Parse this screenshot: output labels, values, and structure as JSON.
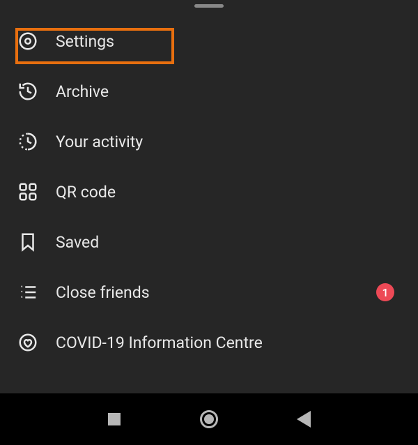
{
  "menu": {
    "items": [
      {
        "label": "Settings",
        "icon": "settings-icon",
        "badge": null,
        "highlighted": true
      },
      {
        "label": "Archive",
        "icon": "archive-icon",
        "badge": null,
        "highlighted": false
      },
      {
        "label": "Your activity",
        "icon": "activity-icon",
        "badge": null,
        "highlighted": false
      },
      {
        "label": "QR code",
        "icon": "qr-icon",
        "badge": null,
        "highlighted": false
      },
      {
        "label": "Saved",
        "icon": "bookmark-icon",
        "badge": null,
        "highlighted": false
      },
      {
        "label": "Close friends",
        "icon": "close-friends-icon",
        "badge": "1",
        "highlighted": false
      },
      {
        "label": "COVID-19 Information Centre",
        "icon": "heart-circle-icon",
        "badge": null,
        "highlighted": false
      }
    ]
  },
  "colors": {
    "highlight": "#e86f0f",
    "badge": "#ed4956",
    "background": "#262626"
  }
}
